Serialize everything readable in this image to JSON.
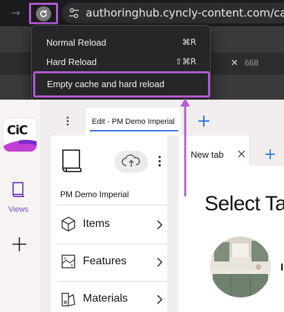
{
  "browser": {
    "url": "authoringhub.cyncly-content.com/catalogs",
    "back_icon": "back-arrow-icon",
    "reload_icon": "reload-icon",
    "site_settings_icon": "site-settings-icon"
  },
  "toolbar_strip": {
    "close_glyph": "✕",
    "number": "668"
  },
  "context_menu": {
    "items": [
      {
        "label": "Normal Reload",
        "shortcut": "⌘R"
      },
      {
        "label": "Hard Reload",
        "shortcut": "⇧⌘R"
      },
      {
        "label": "Empty cache and hard reload",
        "shortcut": ""
      }
    ]
  },
  "app_sidebar": {
    "logo_text": "CiC",
    "views_label": "Views"
  },
  "tabs": {
    "active_tab_label": "Edit - PM Demo Imperial"
  },
  "left_panel": {
    "project_name": "PM Demo Imperial",
    "nav_items": [
      {
        "label": "Items",
        "icon": "cube-icon"
      },
      {
        "label": "Features",
        "icon": "features-icon"
      },
      {
        "label": "Materials",
        "icon": "materials-icon"
      }
    ]
  },
  "right_panel": {
    "tab_label": "New tab",
    "heading": "Select Ta",
    "card_letter": "I"
  },
  "colors": {
    "highlight": "#b55ad3",
    "accent_blue": "#2b73e8",
    "views_purple": "#7b4ac4"
  }
}
